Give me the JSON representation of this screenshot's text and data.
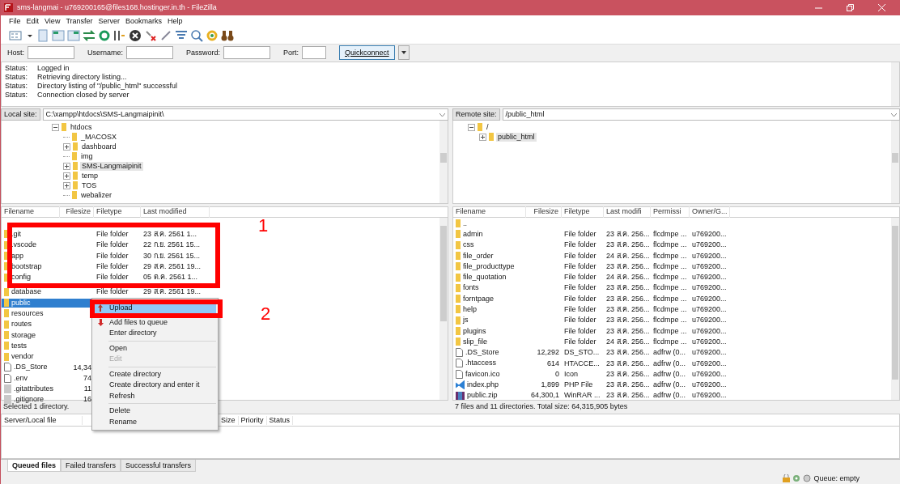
{
  "window": {
    "title": "sms-langmai - u769200165@files168.hostinger.in.th - FileZilla"
  },
  "menu": [
    "File",
    "Edit",
    "View",
    "Transfer",
    "Server",
    "Bookmarks",
    "Help"
  ],
  "quickconnect": {
    "fields": [
      {
        "label": "Host:"
      },
      {
        "label": "Username:"
      },
      {
        "label": "Password:"
      },
      {
        "label": "Port:"
      }
    ],
    "button": "Quickconnect"
  },
  "message_log": [
    {
      "label": "Status:",
      "text": "Logged in"
    },
    {
      "label": "Status:",
      "text": "Retrieving directory listing..."
    },
    {
      "label": "Status:",
      "text": "Directory listing of \"/public_html\" successful"
    },
    {
      "label": "Status:",
      "text": "Connection closed by server"
    }
  ],
  "local": {
    "site_label": "Local site:",
    "path": "C:\\xampp\\htdocs\\SMS-Langmaipinit\\",
    "tree": [
      {
        "name": "htdocs",
        "kind": "branch",
        "expanded": true,
        "selected": false,
        "children": [
          {
            "name": "_MACOSX",
            "kind": "leaf",
            "selected": false
          },
          {
            "name": "dashboard",
            "kind": "branch",
            "expanded": false,
            "selected": false
          },
          {
            "name": "img",
            "kind": "leaf",
            "selected": false
          },
          {
            "name": "SMS-Langmaipinit",
            "kind": "branch",
            "expanded": false,
            "selected": true
          },
          {
            "name": "temp",
            "kind": "branch",
            "expanded": false,
            "selected": false
          },
          {
            "name": "TOS",
            "kind": "branch",
            "expanded": false,
            "selected": false
          },
          {
            "name": "webalizer",
            "kind": "leaf",
            "selected": false
          }
        ]
      }
    ],
    "columns": [
      "Filename",
      "Filesize",
      "Filetype",
      "Last modified"
    ],
    "rows": [
      {
        "name": ".git",
        "kind": "folder",
        "type": "File folder",
        "modified": "23 ส.ค. 2561 1...",
        "selected": false
      },
      {
        "name": ".vscode",
        "kind": "folder",
        "type": "File folder",
        "modified": "22 ก.ย. 2561 15...",
        "selected": false
      },
      {
        "name": "app",
        "kind": "folder",
        "type": "File folder",
        "modified": "30 ก.ย. 2561 15...",
        "selected": false
      },
      {
        "name": "bootstrap",
        "kind": "folder",
        "type": "File folder",
        "modified": "29 ส.ค. 2561 19...",
        "selected": false
      },
      {
        "name": "config",
        "kind": "folder",
        "type": "File folder",
        "modified": "05 ต.ค. 2561 1...",
        "selected": false
      },
      {
        "name": "database",
        "kind": "folder",
        "type": "File folder",
        "modified": "29 ส.ค. 2561 19...",
        "selected": false
      },
      {
        "name": "public",
        "kind": "folder",
        "selected": true
      },
      {
        "name": "resources",
        "kind": "folder",
        "selected": false
      },
      {
        "name": "routes",
        "kind": "folder",
        "selected": false
      },
      {
        "name": "storage",
        "kind": "folder",
        "selected": false
      },
      {
        "name": "tests",
        "kind": "folder",
        "selected": false
      },
      {
        "name": "vendor",
        "kind": "folder",
        "selected": false
      },
      {
        "name": ".DS_Store",
        "kind": "file",
        "size": "14,34",
        "selected": false
      },
      {
        "name": ".env",
        "kind": "file",
        "size": "74",
        "selected": false
      },
      {
        "name": ".gitattributes",
        "kind": "config",
        "size": "11",
        "selected": false
      },
      {
        "name": ".gitignore",
        "kind": "config",
        "size": "16",
        "selected": false
      }
    ],
    "status": "Selected 1 directory."
  },
  "remote": {
    "site_label": "Remote site:",
    "path": "/public_html",
    "tree": [
      {
        "name": "/",
        "kind": "branch",
        "expanded": true,
        "selected": false,
        "children": [
          {
            "name": "public_html",
            "kind": "branch",
            "expanded": false,
            "selected": true
          }
        ]
      }
    ],
    "columns": [
      "Filename",
      "Filesize",
      "Filetype",
      "Last modifi",
      "Permissi",
      "Owner/G..."
    ],
    "rows": [
      {
        "name": "..",
        "kind": "folder",
        "selected": false
      },
      {
        "name": "admin",
        "kind": "folder",
        "type": "File folder",
        "modified": "23 ส.ค. 256...",
        "permissions": "flcdmpe ...",
        "owner": "u769200...",
        "selected": false
      },
      {
        "name": "css",
        "kind": "folder",
        "type": "File folder",
        "modified": "23 ส.ค. 256...",
        "permissions": "flcdmpe ...",
        "owner": "u769200...",
        "selected": false
      },
      {
        "name": "file_order",
        "kind": "folder",
        "type": "File folder",
        "modified": "24 ส.ค. 256...",
        "permissions": "flcdmpe ...",
        "owner": "u769200...",
        "selected": false
      },
      {
        "name": "file_producttype",
        "kind": "folder",
        "type": "File folder",
        "modified": "23 ส.ค. 256...",
        "permissions": "flcdmpe ...",
        "owner": "u769200...",
        "selected": false
      },
      {
        "name": "file_quotation",
        "kind": "folder",
        "type": "File folder",
        "modified": "24 ส.ค. 256...",
        "permissions": "flcdmpe ...",
        "owner": "u769200...",
        "selected": false
      },
      {
        "name": "fonts",
        "kind": "folder",
        "type": "File folder",
        "modified": "23 ส.ค. 256...",
        "permissions": "flcdmpe ...",
        "owner": "u769200...",
        "selected": false
      },
      {
        "name": "forntpage",
        "kind": "folder",
        "type": "File folder",
        "modified": "23 ส.ค. 256...",
        "permissions": "flcdmpe ...",
        "owner": "u769200...",
        "selected": false
      },
      {
        "name": "help",
        "kind": "folder",
        "type": "File folder",
        "modified": "23 ส.ค. 256...",
        "permissions": "flcdmpe ...",
        "owner": "u769200...",
        "selected": false
      },
      {
        "name": "js",
        "kind": "folder",
        "type": "File folder",
        "modified": "23 ส.ค. 256...",
        "permissions": "flcdmpe ...",
        "owner": "u769200...",
        "selected": false
      },
      {
        "name": "plugins",
        "kind": "folder",
        "type": "File folder",
        "modified": "23 ส.ค. 256...",
        "permissions": "flcdmpe ...",
        "owner": "u769200...",
        "selected": false
      },
      {
        "name": "slip_file",
        "kind": "folder",
        "type": "File folder",
        "modified": "24 ส.ค. 256...",
        "permissions": "flcdmpe ...",
        "owner": "u769200...",
        "selected": false
      },
      {
        "name": ".DS_Store",
        "kind": "file",
        "size": "12,292",
        "type": "DS_STO...",
        "modified": "23 ส.ค. 256...",
        "permissions": "adfrw (0...",
        "owner": "u769200...",
        "selected": false
      },
      {
        "name": ".htaccess",
        "kind": "file",
        "size": "614",
        "type": "HTACCE...",
        "modified": "23 ส.ค. 256...",
        "permissions": "adfrw (0...",
        "owner": "u769200...",
        "selected": false
      },
      {
        "name": "favicon.ico",
        "kind": "file",
        "size": "0",
        "type": "Icon",
        "modified": "23 ส.ค. 256...",
        "permissions": "adfrw (0...",
        "owner": "u769200...",
        "selected": false
      },
      {
        "name": "index.php",
        "kind": "code",
        "size": "1,899",
        "type": "PHP File",
        "modified": "23 ส.ค. 256...",
        "permissions": "adfrw (0...",
        "owner": "u769200...",
        "selected": false
      },
      {
        "name": "public.zip",
        "kind": "archive",
        "size": "64,300,1",
        "type": "WinRAR ...",
        "modified": "23 ส.ค. 256...",
        "permissions": "adfrw (0...",
        "owner": "u769200...",
        "selected": false
      }
    ],
    "status": "7 files and 11 directories. Total size: 64,315,905 bytes"
  },
  "context_menu": [
    {
      "kind": "item",
      "label": "Upload",
      "selected": true,
      "disabled": false
    },
    {
      "kind": "item",
      "label": "Add files to queue",
      "selected": false,
      "disabled": false
    },
    {
      "kind": "item",
      "label": "Enter directory",
      "selected": false,
      "disabled": false
    },
    {
      "kind": "separator"
    },
    {
      "kind": "item",
      "label": "Open",
      "selected": false,
      "disabled": false
    },
    {
      "kind": "item",
      "label": "Edit",
      "selected": false,
      "disabled": true
    },
    {
      "kind": "separator"
    },
    {
      "kind": "item",
      "label": "Create directory",
      "selected": false,
      "disabled": false
    },
    {
      "kind": "item",
      "label": "Create directory and enter it",
      "selected": false,
      "disabled": false
    },
    {
      "kind": "item",
      "label": "Refresh",
      "selected": false,
      "disabled": false
    },
    {
      "kind": "separator"
    },
    {
      "kind": "item",
      "label": "Delete",
      "selected": false,
      "disabled": false
    },
    {
      "kind": "item",
      "label": "Rename",
      "selected": false,
      "disabled": false
    }
  ],
  "queue": {
    "columns": [
      "Server/Local file",
      "Size",
      "Priority",
      "Status"
    ]
  },
  "tabs": [
    {
      "label": "Queued files",
      "selected": true
    },
    {
      "label": "Failed transfers",
      "selected": false
    },
    {
      "label": "Successful transfers",
      "selected": false
    }
  ],
  "status_bar": {
    "queue": "Queue: empty"
  },
  "annotations": [
    {
      "label": "1"
    },
    {
      "label": "2"
    }
  ]
}
